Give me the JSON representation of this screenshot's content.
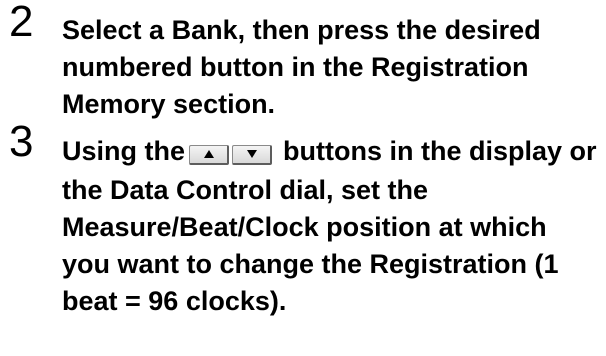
{
  "steps": [
    {
      "number": "2",
      "text": "Select a Bank, then press the desired numbered button in the Registration Memory section."
    },
    {
      "number": "3",
      "text_before": "Using the",
      "buttons": [
        {
          "icon": "up-triangle-icon"
        },
        {
          "icon": "down-triangle-icon"
        }
      ],
      "text_after": "buttons in the display or the Data Control dial, set the Measure/Beat/Clock position at which you want to change the Registration (1 beat = 96 clocks)."
    }
  ]
}
